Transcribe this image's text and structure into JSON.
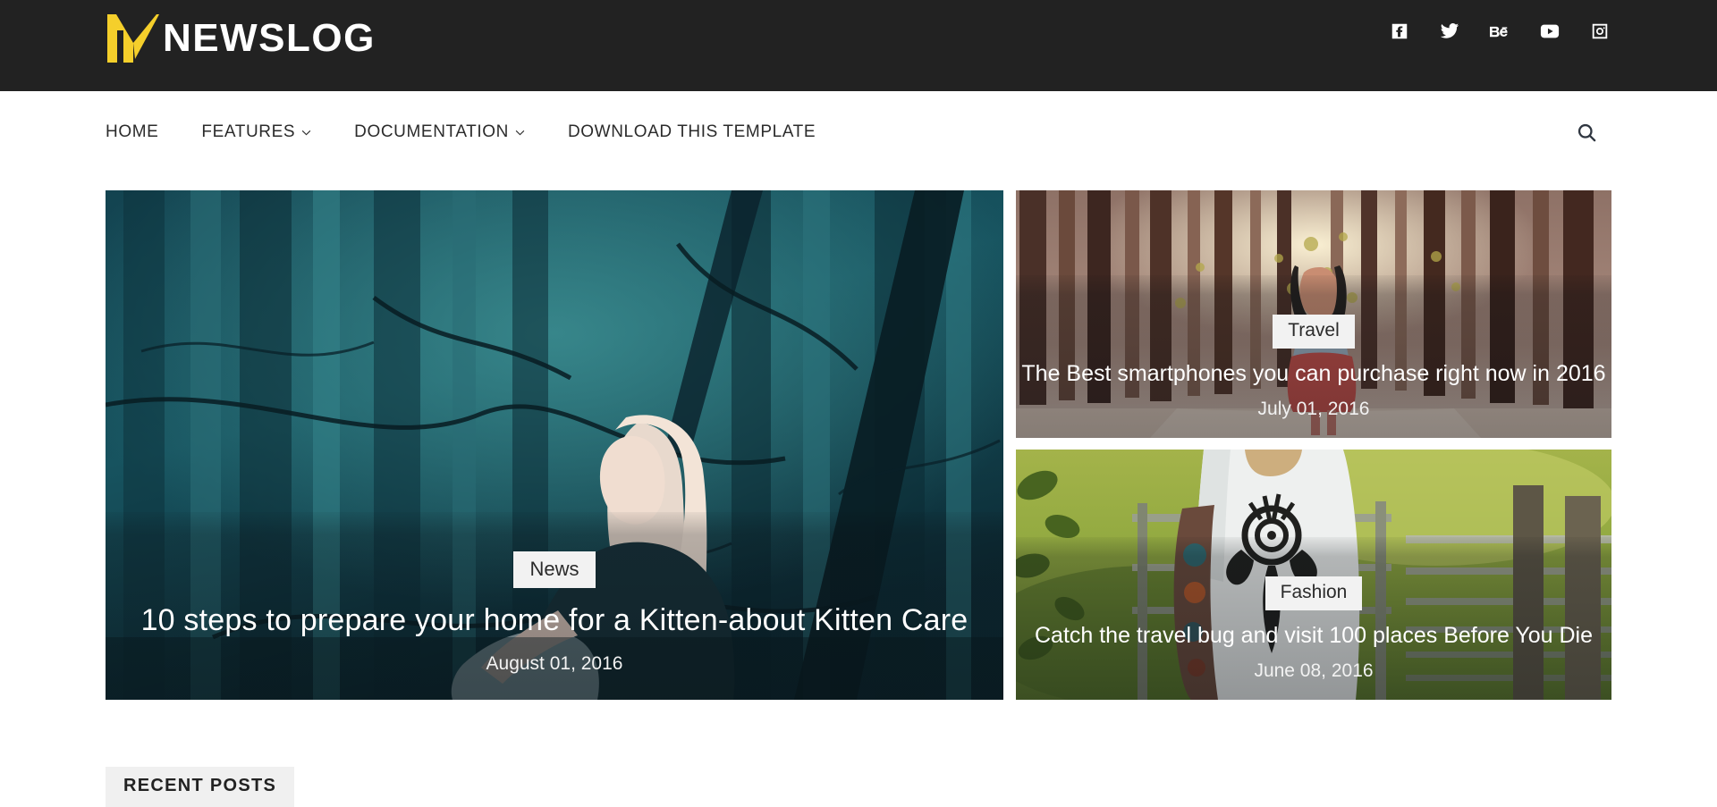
{
  "site": {
    "brand_text": "NEWSLOG",
    "logo_icon": "newslog-m-mark-icon",
    "brand_accent_color": "#f5cf2b",
    "topbar_color": "#222222"
  },
  "social": {
    "items": [
      {
        "name": "facebook-icon",
        "label": "Facebook"
      },
      {
        "name": "twitter-icon",
        "label": "Twitter"
      },
      {
        "name": "behance-icon",
        "label": "Behance"
      },
      {
        "name": "youtube-icon",
        "label": "YouTube"
      },
      {
        "name": "instagram-icon",
        "label": "Instagram"
      }
    ]
  },
  "nav": {
    "items": [
      {
        "label": "HOME",
        "has_caret": false
      },
      {
        "label": "FEATURES",
        "has_caret": true
      },
      {
        "label": "DOCUMENTATION",
        "has_caret": true
      },
      {
        "label": "DOWNLOAD THIS TEMPLATE",
        "has_caret": false
      }
    ],
    "search_icon": "search-icon"
  },
  "featured": {
    "hero": {
      "category": "News",
      "title": "10 steps to prepare your home for a Kitten-about Kitten Care",
      "date": "August 01, 2016",
      "image_description": "Blonde woman sitting in a dark teal forest looking upward"
    },
    "side": [
      {
        "category": "Travel",
        "title": "The Best smartphones you can purchase right now in 2016",
        "date": "July 01, 2016",
        "image_description": "Woman in red and white dress walking a sandy path through a pine forest"
      },
      {
        "category": "Fashion",
        "title": "Catch the travel bug and visit 100 places Before You Die",
        "date": "June 08, 2016",
        "image_description": "Person in white rose-print dress with tattooed arm by a wooden gate in a green field"
      }
    ]
  },
  "recent": {
    "tab_label": "RECENT POSTS"
  }
}
